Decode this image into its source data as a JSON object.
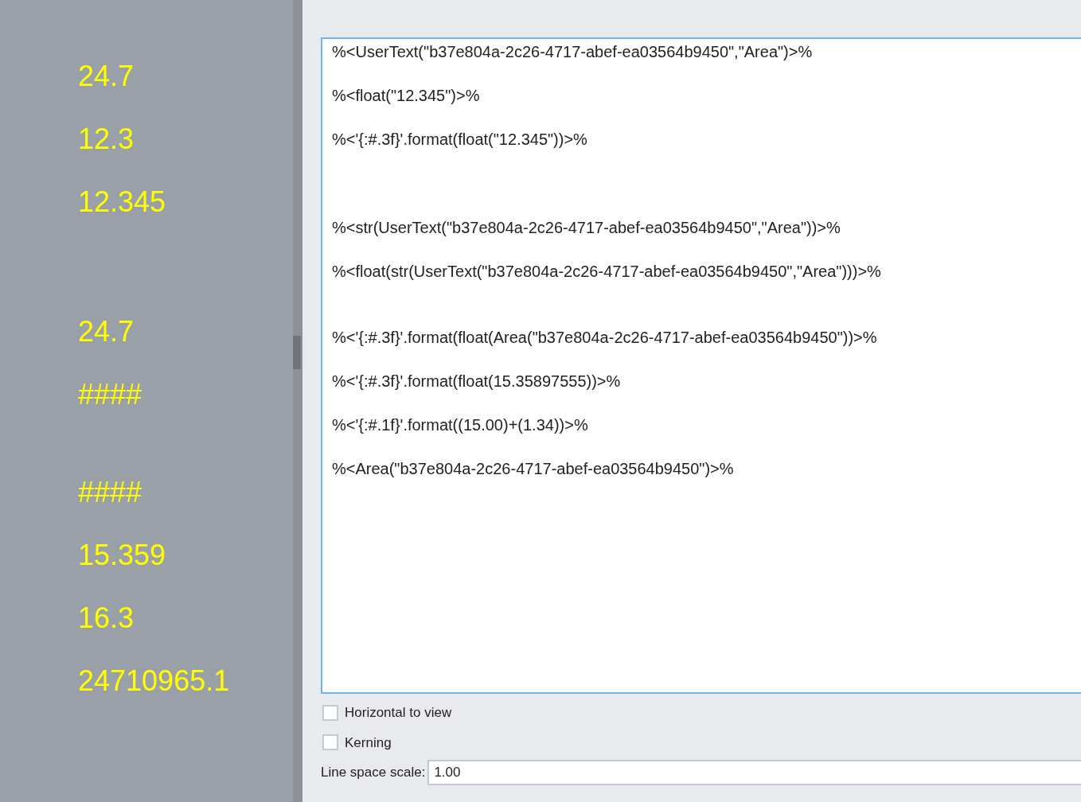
{
  "preview": {
    "groups": [
      [
        "24.7",
        "12.3",
        "12.345"
      ],
      [
        "24.7",
        "####"
      ],
      [
        "####",
        "15.359",
        "16.3",
        "24710965.1"
      ]
    ]
  },
  "editor": {
    "groups": [
      [
        "%<UserText(\"b37e804a-2c26-4717-abef-ea03564b9450\",\"Area\")>%",
        "%<float(\"12.345\")>%",
        "%<'{:#.3f}'.format(float(\"12.345\"))>%"
      ],
      [
        "%<str(UserText(\"b37e804a-2c26-4717-abef-ea03564b9450\",\"Area\"))>%",
        "%<float(str(UserText(\"b37e804a-2c26-4717-abef-ea03564b9450\",\"Area\")))>%"
      ],
      [
        "%<'{:#.3f}'.format(float(Area(\"b37e804a-2c26-4717-abef-ea03564b9450\"))>%",
        "%<'{:#.3f}'.format(float(15.35897555))>%",
        "%<'{:#.1f}'.format((15.00)+(1.34))>%",
        "%<Area(\"b37e804a-2c26-4717-abef-ea03564b9450\")>%"
      ]
    ]
  },
  "options": [
    {
      "label": "Horizontal to view",
      "checked": false
    },
    {
      "label": "Kerning",
      "checked": false
    }
  ],
  "line_space_scale": {
    "label": "Line space scale:",
    "value": "1.00"
  }
}
